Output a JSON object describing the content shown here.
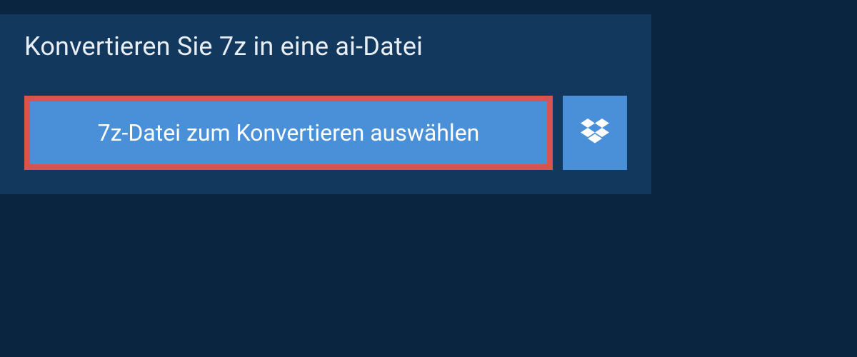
{
  "header": {
    "title": "Konvertieren Sie 7z in eine ai-Datei"
  },
  "actions": {
    "choose_file_label": "7z-Datei zum Konvertieren auswählen",
    "dropbox_icon": "dropbox-icon"
  },
  "colors": {
    "background": "#0a2540",
    "panel": "#12385e",
    "button": "#4a90d9",
    "highlight_border": "#d9534f",
    "text_light": "#e8eef4",
    "text_white": "#ffffff"
  }
}
